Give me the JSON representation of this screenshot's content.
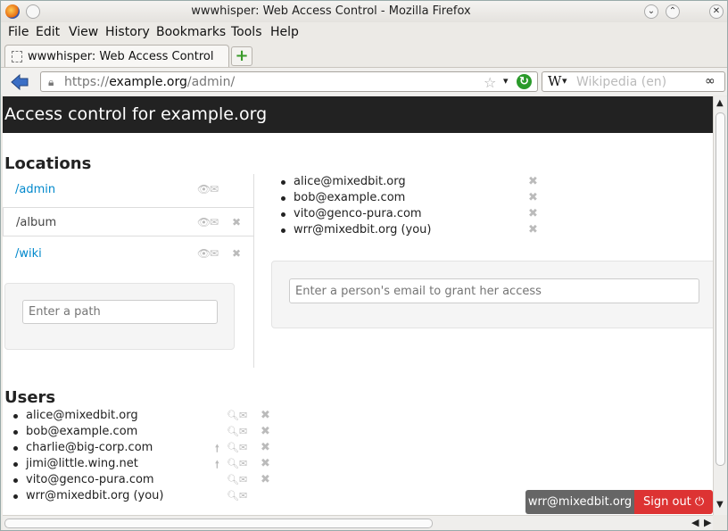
{
  "window": {
    "title": "wwwhisper: Web Access Control - Mozilla Firefox"
  },
  "menu": [
    "File",
    "Edit",
    "View",
    "History",
    "Bookmarks",
    "Tools",
    "Help"
  ],
  "tab": {
    "label": "wwwhisper: Web Access Control"
  },
  "address": {
    "scheme": "https://",
    "host": "example.org",
    "path": "/admin/"
  },
  "search": {
    "engine_icon": "W",
    "placeholder": "Wikipedia (en)"
  },
  "page": {
    "header": "Access control for example.org",
    "locations_heading": "Locations",
    "locations": [
      {
        "path": "/admin",
        "selected": false,
        "removable": false
      },
      {
        "path": "/album",
        "selected": true,
        "removable": true
      },
      {
        "path": "/wiki",
        "selected": false,
        "removable": true
      }
    ],
    "path_placeholder": "Enter a path",
    "allowed_users": [
      "alice@mixedbit.org",
      "bob@example.com",
      "vito@genco-pura.com",
      "wrr@mixedbit.org (you)"
    ],
    "grant_placeholder": "Enter a person's email to grant her access",
    "users_heading": "Users",
    "users": [
      {
        "email": "alice@mixedbit.org",
        "can_add": false,
        "removable": true
      },
      {
        "email": "bob@example.com",
        "can_add": false,
        "removable": true
      },
      {
        "email": "charlie@big-corp.com",
        "can_add": true,
        "removable": true
      },
      {
        "email": "jimi@little.wing.net",
        "can_add": true,
        "removable": true
      },
      {
        "email": "vito@genco-pura.com",
        "can_add": false,
        "removable": true
      },
      {
        "email": "wrr@mixedbit.org (you)",
        "can_add": false,
        "removable": false
      }
    ],
    "current_user": "wrr@mixedbit.org",
    "signout_label": "Sign out"
  }
}
